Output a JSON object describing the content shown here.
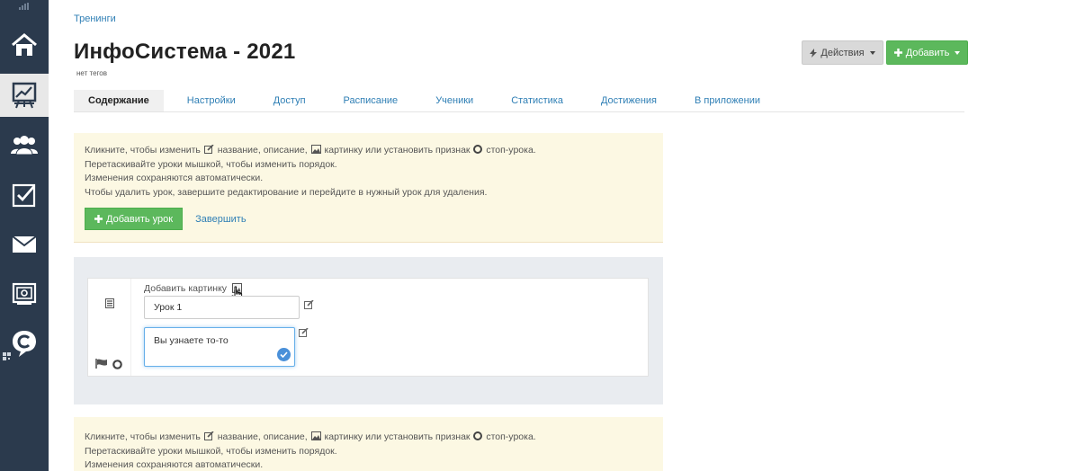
{
  "breadcrumb": "Тренинги",
  "title": "ИнфоСистема - 2021",
  "tags": "нет тегов",
  "header_buttons": {
    "actions": "Действия",
    "add": "Добавить"
  },
  "tabs": [
    {
      "label": "Содержание",
      "active": true
    },
    {
      "label": "Настройки"
    },
    {
      "label": "Доступ"
    },
    {
      "label": "Расписание"
    },
    {
      "label": "Ученики"
    },
    {
      "label": "Статистика"
    },
    {
      "label": "Достижения"
    },
    {
      "label": "В приложении"
    }
  ],
  "notice": {
    "line1_a": "Кликните, чтобы изменить",
    "line1_b": "название, описание,",
    "line1_c": "картинку или установить признак",
    "line1_d": "стоп-урока.",
    "line2": "Перетаскивайте уроки мышкой, чтобы изменить порядок.",
    "line3": "Изменения сохраняются автоматически.",
    "line4": "Чтобы удалить урок, завершите редактирование и перейдите в нужный урок для удаления.",
    "add_lesson": "Добавить урок",
    "finish": "Завершить"
  },
  "lesson": {
    "add_image_label": "Добавить картинку",
    "title_value": "Урок 1",
    "description_value": "Вы узнаете то-то"
  },
  "colors": {
    "rail": "#2b3a4d",
    "link": "#2f7fb5",
    "success": "#5cb85c",
    "notice_bg": "#fcf8e3",
    "editor_bg": "#e9ecf0"
  }
}
